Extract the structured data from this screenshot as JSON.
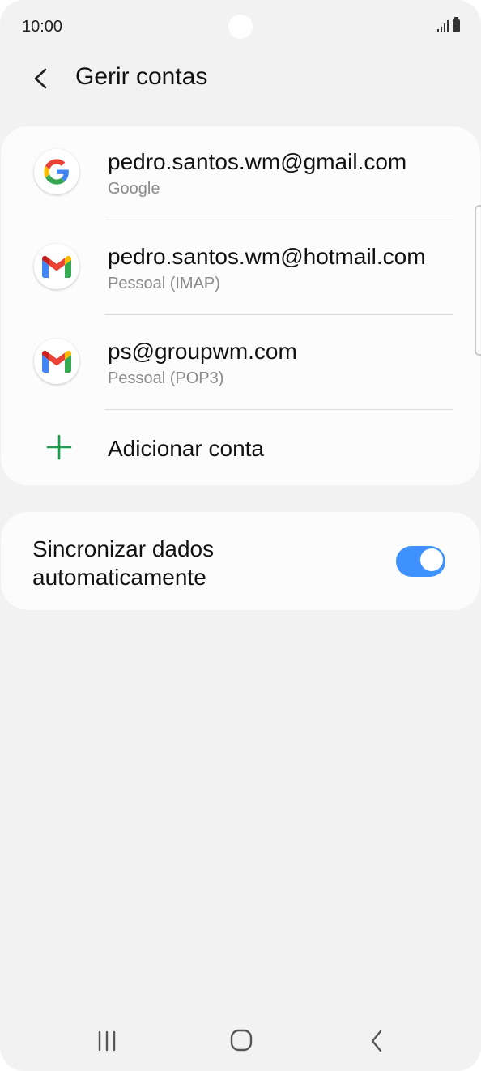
{
  "status_bar": {
    "time": "10:00"
  },
  "header": {
    "title": "Gerir contas"
  },
  "accounts": [
    {
      "email": "pedro.santos.wm@gmail.com",
      "type": "Google",
      "icon": "google-icon"
    },
    {
      "email": "pedro.santos.wm@hotmail.com",
      "type": "Pessoal (IMAP)",
      "icon": "gmail-icon"
    },
    {
      "email": "ps@groupwm.com",
      "type": "Pessoal (POP3)",
      "icon": "gmail-icon"
    }
  ],
  "add_account": {
    "label": "Adicionar conta",
    "icon": "plus-icon"
  },
  "sync": {
    "label": "Sincronizar dados automaticamente",
    "enabled": true
  },
  "colors": {
    "background": "#f2f2f2",
    "card": "#fcfcfc",
    "accent_blue": "#3e91ff",
    "add_green": "#1b9e4b",
    "secondary_text": "#8a8a8a"
  }
}
